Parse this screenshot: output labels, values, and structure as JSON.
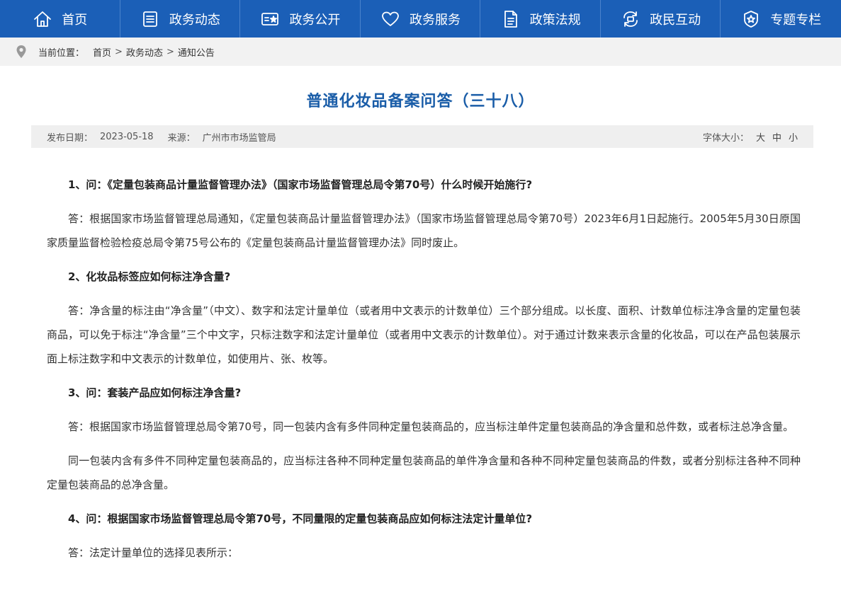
{
  "nav": [
    {
      "label": "首页",
      "icon": "home-icon"
    },
    {
      "label": "政务动态",
      "icon": "news-icon"
    },
    {
      "label": "政务公开",
      "icon": "id-card-icon"
    },
    {
      "label": "政务服务",
      "icon": "heart-icon"
    },
    {
      "label": "政策法规",
      "icon": "document-icon"
    },
    {
      "label": "政民互动",
      "icon": "interaction-icon"
    },
    {
      "label": "专题专栏",
      "icon": "badge-icon"
    }
  ],
  "breadcrumb": {
    "prefix": "当前位置：",
    "items": [
      "首页",
      "政务动态",
      "通知公告"
    ],
    "separator": ">"
  },
  "article": {
    "title": "普通化妆品备案问答（三十八）",
    "meta": {
      "date_label": "发布日期：",
      "date": "2023-05-18",
      "source_label": "来源：",
      "source": "广州市市场监管局",
      "font_size_label": "字体大小：",
      "font_sizes": [
        "大",
        "中",
        "小"
      ]
    },
    "paragraphs": [
      {
        "type": "q",
        "text": "1、问：《定量包装商品计量监督管理办法》（国家市场监督管理总局令第70号）什么时候开始施行?"
      },
      {
        "type": "a",
        "text": "答：根据国家市场监督管理总局通知，《定量包装商品计量监督管理办法》（国家市场监督管理总局令第70号）2023年6月1日起施行。2005年5月30日原国家质量监督检验检疫总局令第75号公布的《定量包装商品计量监督管理办法》同时废止。"
      },
      {
        "type": "q",
        "text": "2、化妆品标签应如何标注净含量?"
      },
      {
        "type": "a",
        "text": "答：净含量的标注由“净含量”（中文）、数字和法定计量单位（或者用中文表示的计数单位）三个部分组成。以长度、面积、计数单位标注净含量的定量包装商品，可以免于标注“净含量”三个中文字，只标注数字和法定计量单位（或者用中文表示的计数单位）。对于通过计数来表示含量的化妆品，可以在产品包装展示面上标注数字和中文表示的计数单位，如使用片、张、枚等。"
      },
      {
        "type": "q",
        "text": "3、问：套装产品应如何标注净含量?"
      },
      {
        "type": "a",
        "text": "答：根据国家市场监督管理总局令第70号，同一包装内含有多件同种定量包装商品的，应当标注单件定量包装商品的净含量和总件数，或者标注总净含量。"
      },
      {
        "type": "a",
        "text": "同一包装内含有多件不同种定量包装商品的，应当标注各种不同种定量包装商品的单件净含量和各种不同种定量包装商品的件数，或者分别标注各种不同种定量包装商品的总净含量。"
      },
      {
        "type": "q",
        "text": "4、问：根据国家市场监督管理总局令第70号，不同量限的定量包装商品应如何标注法定计量单位?"
      },
      {
        "type": "a",
        "text": "答：法定计量单位的选择见表所示："
      }
    ]
  }
}
